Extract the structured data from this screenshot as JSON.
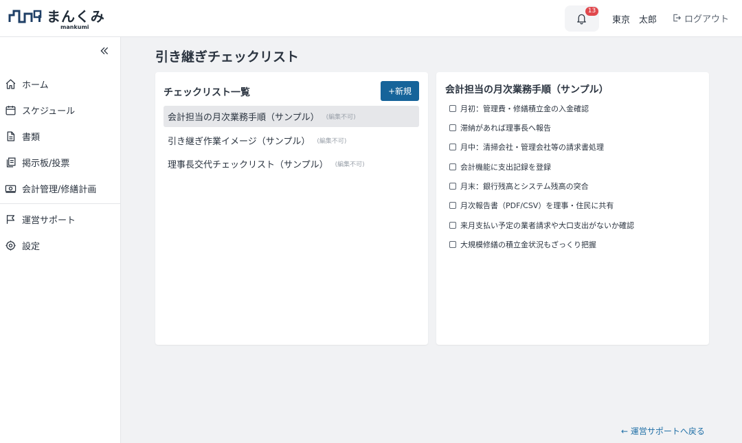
{
  "header": {
    "logo_text": "まんくみ",
    "logo_sub": "mankumi",
    "notification_count": "13",
    "user_name": "東京　太郎",
    "logout_label": "ログアウト"
  },
  "sidebar": {
    "items": [
      {
        "label": "ホーム",
        "icon": "home-icon"
      },
      {
        "label": "スケジュール",
        "icon": "calendar-icon"
      },
      {
        "label": "書類",
        "icon": "document-icon"
      },
      {
        "label": "掲示板/投票",
        "icon": "board-icon"
      },
      {
        "label": "会計管理/修繕計画",
        "icon": "money-icon"
      },
      {
        "label": "運営サポート",
        "icon": "flag-icon"
      },
      {
        "label": "設定",
        "icon": "gear-icon"
      }
    ]
  },
  "main": {
    "page_title": "引き継ぎチェックリスト",
    "list_heading": "チェックリスト一覧",
    "new_button": "+新規",
    "lists": [
      {
        "name": "会計担当の月次業務手順（サンプル）",
        "tag": "(編集不可)"
      },
      {
        "name": "引き継ぎ作業イメージ（サンプル）",
        "tag": "(編集不可)"
      },
      {
        "name": "理事長交代チェックリスト（サンプル）",
        "tag": "(編集不可)"
      }
    ],
    "detail_heading": "会計担当の月次業務手順（サンプル）",
    "checklist": [
      "月初：管理費・修繕積立金の入金確認",
      "滞納があれば理事長へ報告",
      "月中：清掃会社・管理会社等の請求書処理",
      "会計機能に支出記録を登録",
      "月末：銀行残高とシステム残高の突合",
      "月次報告書（PDF/CSV）を理事・住民に共有",
      "来月支払い予定の業者請求や大口支出がないか確認",
      "大規模修繕の積立金状況もざっくり把握"
    ],
    "back_link": "← 運営サポートへ戻る"
  },
  "colors": {
    "primary": "#16649a",
    "badge": "#e0484d",
    "link": "#1f6fa6"
  }
}
